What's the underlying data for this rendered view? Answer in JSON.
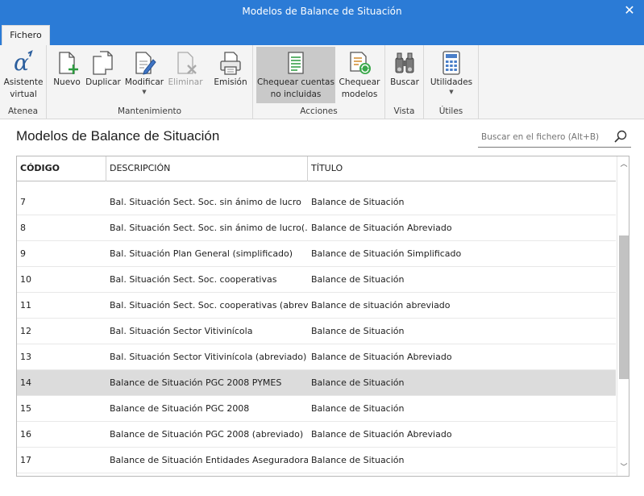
{
  "window": {
    "title": "Modelos de Balance de Situación",
    "close_symbol": "✕"
  },
  "tabs": [
    {
      "label": "Fichero"
    }
  ],
  "ribbon": {
    "groups": [
      {
        "label": "Atenea",
        "buttons": [
          {
            "label": "Asistente virtual",
            "icon": "alpha-icon"
          }
        ]
      },
      {
        "label": "Mantenimiento",
        "buttons": [
          {
            "label": "Nuevo",
            "icon": "new-document-icon"
          },
          {
            "label": "Duplicar",
            "icon": "duplicate-icon"
          },
          {
            "label": "Modificar",
            "icon": "edit-icon",
            "has_dropdown": true
          },
          {
            "label": "Eliminar",
            "icon": "delete-icon",
            "disabled": true
          },
          {
            "label": "Emisión",
            "icon": "print-icon"
          }
        ]
      },
      {
        "label": "Acciones",
        "buttons": [
          {
            "label": "Chequear cuentas no incluidas",
            "icon": "check-accounts-icon",
            "active": true
          },
          {
            "label": "Chequear modelos",
            "icon": "check-models-icon"
          }
        ]
      },
      {
        "label": "Vista",
        "buttons": [
          {
            "label": "Buscar",
            "icon": "binoculars-icon"
          }
        ]
      },
      {
        "label": "Útiles",
        "buttons": [
          {
            "label": "Utilidades",
            "icon": "calculator-icon",
            "has_dropdown": true
          }
        ]
      }
    ]
  },
  "page": {
    "heading": "Modelos de Balance de Situación"
  },
  "search": {
    "placeholder": "Buscar en el fichero (Alt+B)"
  },
  "table": {
    "columns": [
      "CÓDIGO",
      "DESCRIPCIÓN",
      "TÍTULO"
    ],
    "selected_code": "14",
    "rows": [
      {
        "code": "7",
        "description": "Bal. Situación Sect. Soc. sin ánimo de lucro",
        "title": "Balance de Situación"
      },
      {
        "code": "8",
        "description": "Bal. Situación Sect. Soc. sin ánimo de lucro(…",
        "title": "Balance de Situación Abreviado"
      },
      {
        "code": "9",
        "description": "Bal. Situación Plan General (simplificado)",
        "title": "Balance de Situación Simplificado"
      },
      {
        "code": "10",
        "description": "Bal. Situación Sect. Soc. cooperativas",
        "title": "Balance de Situación"
      },
      {
        "code": "11",
        "description": "Bal. Situación Sect. Soc. cooperativas (abrevi",
        "title": "Balance de situación abreviado"
      },
      {
        "code": "12",
        "description": "Bal. Situación Sector Vitivinícola",
        "title": "Balance de Situación"
      },
      {
        "code": "13",
        "description": "Bal. Situación Sector Vitivinícola (abreviado)",
        "title": "Balance de Situación Abreviado"
      },
      {
        "code": "14",
        "description": "Balance de Situación PGC 2008 PYMES",
        "title": "Balance de Situación"
      },
      {
        "code": "15",
        "description": "Balance de Situación PGC 2008",
        "title": "Balance de Situación"
      },
      {
        "code": "16",
        "description": "Balance de Situación PGC 2008 (abreviado)",
        "title": "Balance de Situación Abreviado"
      },
      {
        "code": "17",
        "description": "Balance de Situación Entidades Aseguradoras",
        "title": "Balance de Situación"
      }
    ]
  },
  "colors": {
    "titlebar": "#2b7bd6",
    "ribbon": "#f4f4f4",
    "selected_row": "#dcdcdc",
    "active_button": "#c9c9c9"
  }
}
